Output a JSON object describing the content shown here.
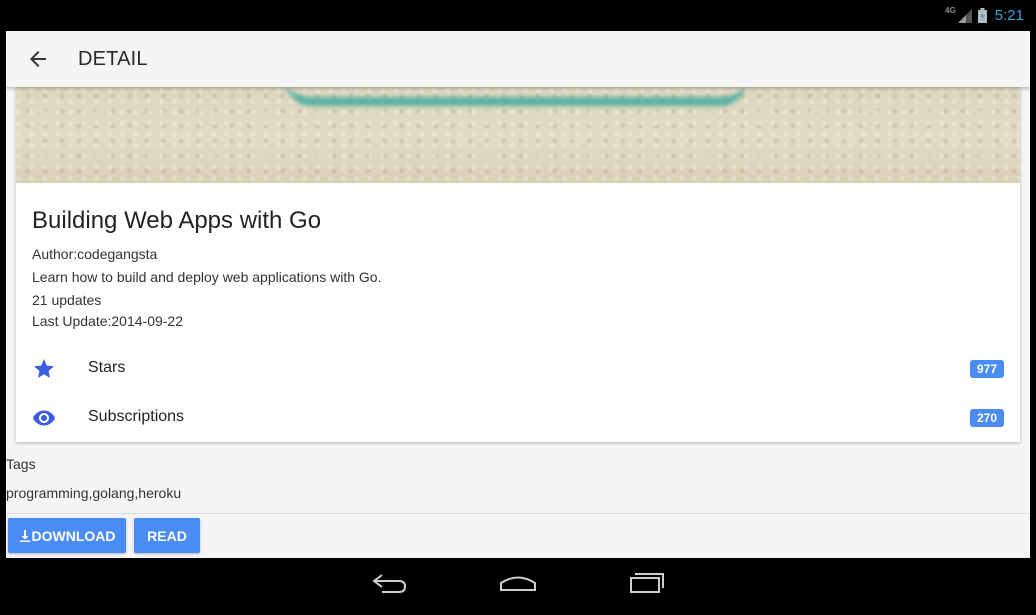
{
  "status_bar": {
    "network": "4G",
    "time": "5:21"
  },
  "app_bar": {
    "title": "DETAIL"
  },
  "book": {
    "title": "Building Web Apps with Go",
    "author": "Author:codegangsta",
    "description": "Learn how to build and deploy web applications with Go.",
    "updates": "21 updates",
    "last_update": "Last Update:2014-09-22"
  },
  "stats": {
    "stars": {
      "label": "Stars",
      "count": "977",
      "icon": "star-icon"
    },
    "subscriptions": {
      "label": "Subscriptions",
      "count": "270",
      "icon": "eye-icon"
    }
  },
  "tags": {
    "label": "Tags",
    "value": "programming,golang,heroku"
  },
  "actions": {
    "download_label": "DOWNLOAD",
    "read_label": "READ"
  },
  "colors": {
    "accent": "#4a8cf3",
    "icon_blue": "#3b5ee0",
    "clock": "#39a6dd"
  }
}
